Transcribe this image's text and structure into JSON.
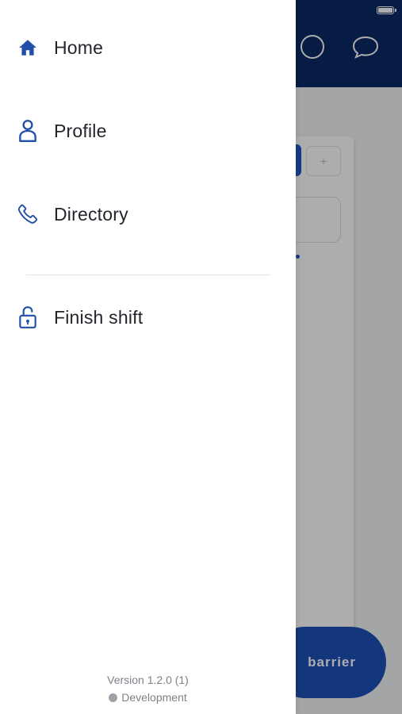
{
  "background_app": {
    "fab_label": "barrier",
    "tab_secondary_glyph": "+",
    "header_icons": [
      "circle-icon",
      "chat-bubble-icon"
    ]
  },
  "drawer": {
    "menu": [
      {
        "label": "Home",
        "icon": "home-icon"
      },
      {
        "label": "Profile",
        "icon": "person-icon"
      },
      {
        "label": "Directory",
        "icon": "phone-icon"
      },
      {
        "label": "Finish shift",
        "icon": "unlock-icon"
      }
    ],
    "footer": {
      "version": "Version 1.2.0 (1)",
      "environment": "Development"
    }
  },
  "colors": {
    "brand_dark": "#0a2a66",
    "brand_blue": "#1e50b7",
    "icon_blue": "#1f4fa8"
  }
}
